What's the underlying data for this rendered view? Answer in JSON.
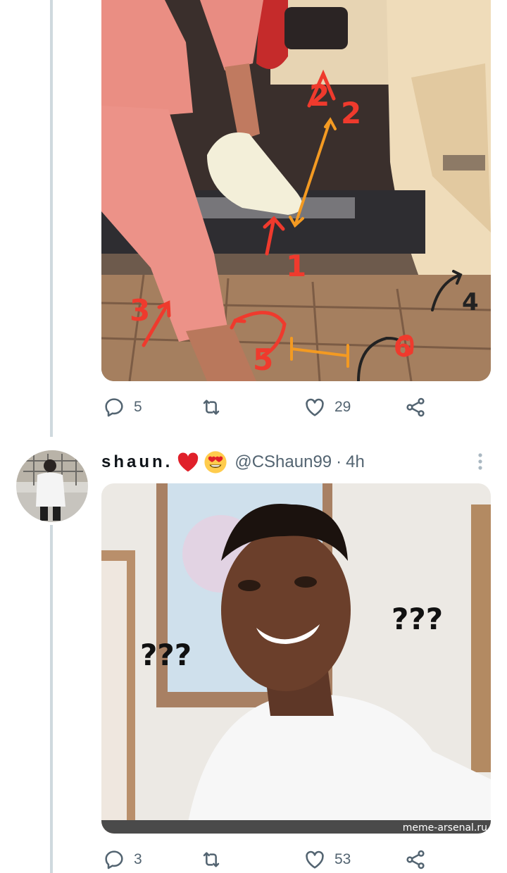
{
  "tweets": [
    {
      "id": "tweet-1",
      "media_description": "car-door-photo-with-annotations",
      "media_annotations": [
        "1",
        "2",
        "2",
        "3",
        "4",
        "5",
        "6"
      ],
      "stats": {
        "replies": "5",
        "retweets": "",
        "likes": "29"
      }
    },
    {
      "id": "tweet-2",
      "author": {
        "display_name": "shaun.",
        "handle": "@CShaun99",
        "separator": "·",
        "time": "4h",
        "emojis": [
          "red-heart-emoji",
          "heart-eyes-emoji"
        ]
      },
      "media_description": "confused-face-meme",
      "media_texts": {
        "left": "???",
        "right": "???",
        "watermark": "meme-arsenal.ru"
      },
      "stats": {
        "replies": "3",
        "retweets": "",
        "likes": "53"
      }
    }
  ],
  "colors": {
    "icon": "#536471",
    "thread_line": "#cfd9de",
    "accent_red": "#f91880"
  }
}
